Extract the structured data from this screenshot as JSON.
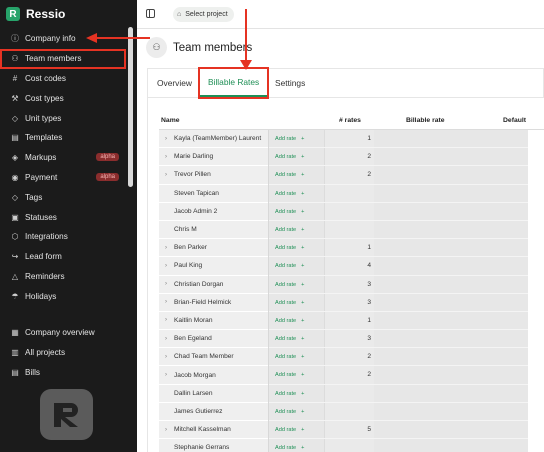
{
  "brand": {
    "name": "Ressio",
    "logo_letter": "R"
  },
  "sidebar": {
    "items": [
      {
        "label": "Company info",
        "icon": "info-icon",
        "glyph": "ⓘ"
      },
      {
        "label": "Team members",
        "icon": "users-icon",
        "glyph": "⚇"
      },
      {
        "label": "Cost codes",
        "icon": "hash-icon",
        "glyph": "#"
      },
      {
        "label": "Cost types",
        "icon": "wrench-icon",
        "glyph": "⚒"
      },
      {
        "label": "Unit types",
        "icon": "tag-icon",
        "glyph": "◇"
      },
      {
        "label": "Templates",
        "icon": "template-icon",
        "glyph": "▤"
      },
      {
        "label": "Markups",
        "icon": "markup-icon",
        "glyph": "◈",
        "badge": "alpha"
      },
      {
        "label": "Payment",
        "icon": "payment-icon",
        "glyph": "◉",
        "badge": "alpha"
      },
      {
        "label": "Tags",
        "icon": "tags-icon",
        "glyph": "◇"
      },
      {
        "label": "Statuses",
        "icon": "status-icon",
        "glyph": "▣"
      },
      {
        "label": "Integrations",
        "icon": "integrations-icon",
        "glyph": "⬡"
      },
      {
        "label": "Lead form",
        "icon": "lead-form-icon",
        "glyph": "↪"
      },
      {
        "label": "Reminders",
        "icon": "bell-icon",
        "glyph": "△"
      },
      {
        "label": "Holidays",
        "icon": "holiday-icon",
        "glyph": "☂"
      }
    ],
    "bottom_items": [
      {
        "label": "Company overview",
        "icon": "overview-icon",
        "glyph": "▦"
      },
      {
        "label": "All projects",
        "icon": "projects-icon",
        "glyph": "▥"
      },
      {
        "label": "Bills",
        "icon": "bills-icon",
        "glyph": "▤"
      }
    ]
  },
  "topbar": {
    "select_project": "Select project"
  },
  "page": {
    "title": "Team members",
    "tabs": [
      "Overview",
      "Billable Rates",
      "Settings"
    ]
  },
  "table": {
    "headers": {
      "name": "Name",
      "rates": "# rates",
      "billable_rate": "Billable rate",
      "default": "Default"
    },
    "add_rate_label": "Add rate",
    "rows": [
      {
        "name": "Kayla (TeamMember) Laurent",
        "rates": "1",
        "expandable": true
      },
      {
        "name": "Marie Darling",
        "rates": "2",
        "expandable": true
      },
      {
        "name": "Trevor Pillen",
        "rates": "2",
        "expandable": true
      },
      {
        "name": "Steven Tapican",
        "rates": "",
        "expandable": false
      },
      {
        "name": "Jacob Admin 2",
        "rates": "",
        "expandable": false
      },
      {
        "name": "Chris M",
        "rates": "",
        "expandable": false
      },
      {
        "name": "Ben Parker",
        "rates": "1",
        "expandable": true
      },
      {
        "name": "Paul King",
        "rates": "4",
        "expandable": true
      },
      {
        "name": "Christian Dorgan",
        "rates": "3",
        "expandable": true
      },
      {
        "name": "Brian-Field Helmick",
        "rates": "3",
        "expandable": true
      },
      {
        "name": "Kaitlin Moran",
        "rates": "1",
        "expandable": true
      },
      {
        "name": "Ben Egeland",
        "rates": "3",
        "expandable": true
      },
      {
        "name": "Chad Team Member",
        "rates": "2",
        "expandable": true
      },
      {
        "name": "Jacob Morgan",
        "rates": "2",
        "expandable": true
      },
      {
        "name": "Dallin Larsen",
        "rates": "",
        "expandable": false
      },
      {
        "name": "James Gutierrez",
        "rates": "",
        "expandable": false
      },
      {
        "name": "Mitchell Kasselman",
        "rates": "5",
        "expandable": true
      },
      {
        "name": "Stephanie Gerrans",
        "rates": "",
        "expandable": false
      }
    ]
  },
  "colors": {
    "accent": "#1f8f56",
    "highlight": "#e53323",
    "sidebar_bg": "#1b1b1b"
  }
}
